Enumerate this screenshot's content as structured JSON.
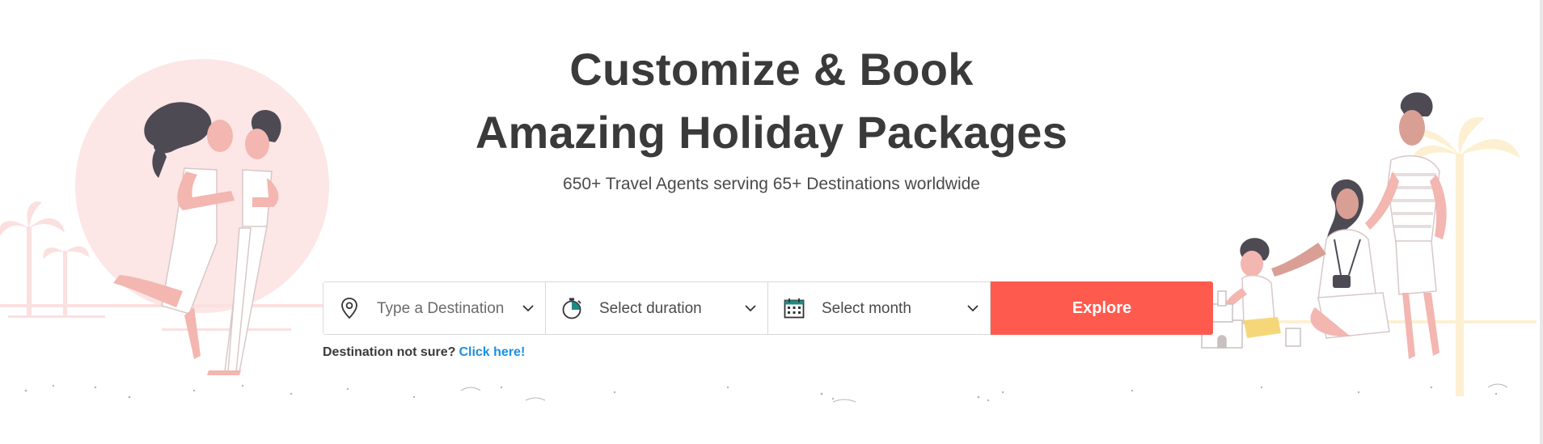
{
  "hero": {
    "title_line1": "Customize & Book",
    "title_line2": "Amazing Holiday Packages",
    "subtitle": "650+ Travel Agents serving 65+ Destinations worldwide"
  },
  "search": {
    "destination": {
      "placeholder": "Type a Destination",
      "icon": "location-pin-icon"
    },
    "duration": {
      "label": "Select duration",
      "icon": "stopwatch-icon"
    },
    "month": {
      "label": "Select month",
      "icon": "calendar-icon"
    },
    "explore_label": "Explore"
  },
  "hint": {
    "text": "Destination not sure?",
    "link": "Click here!"
  },
  "colors": {
    "accent": "#ff5a4e",
    "link": "#1a8fe3",
    "heading": "#3a3a3a",
    "icon_teal": "#1f8a84"
  }
}
